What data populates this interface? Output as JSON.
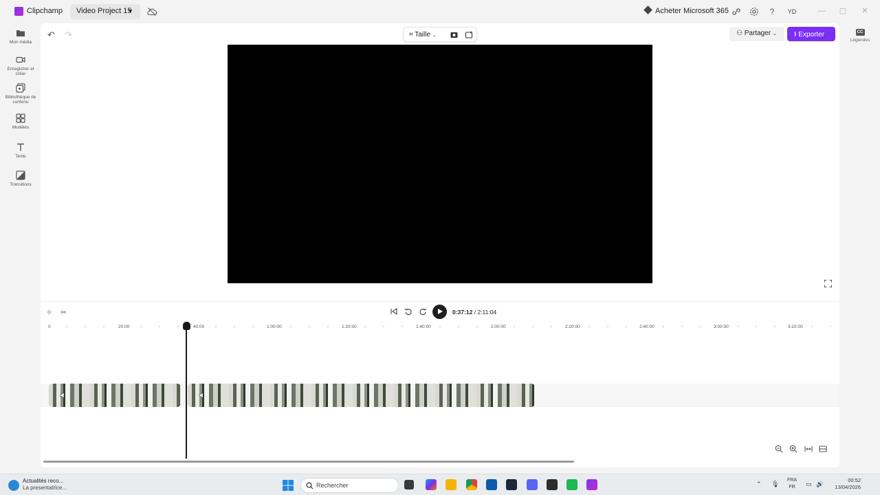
{
  "titlebar": {
    "app_name": "Clipchamp",
    "project_name": "Video Project 15",
    "buy_label": "Acheter Microsoft 365",
    "avatar_initials": "YD"
  },
  "sidebar": {
    "items": [
      {
        "label": "Mon média",
        "icon": "folder-icon"
      },
      {
        "label": "Enregistrer et créer",
        "icon": "camera-icon"
      },
      {
        "label": "Bibliothèque de contenu",
        "icon": "library-icon"
      },
      {
        "label": "Modèles",
        "icon": "templates-icon"
      },
      {
        "label": "Texte",
        "icon": "text-icon"
      },
      {
        "label": "Transitions",
        "icon": "transitions-icon"
      }
    ]
  },
  "toolbar": {
    "size_label": "Taille",
    "share_label": "Partager",
    "export_label": "Exporter"
  },
  "right_rail": {
    "captions_label": "Légendes",
    "captions_icon_text": "CC"
  },
  "playback": {
    "current_time": "0:37:12",
    "separator": "/",
    "total_time": "2:11:04"
  },
  "ruler": {
    "labels": [
      "0",
      "20:00",
      "40:00",
      "1:00:00",
      "1:20:00",
      "1:40:00",
      "2:00:00",
      "2:20:00",
      "2:40:00",
      "3:00:00",
      "3:20:00"
    ]
  },
  "taskbar": {
    "news_title": "Actualités reco...",
    "news_subtitle": "La presentatrice...",
    "search_placeholder": "Rechercher",
    "lang_line1": "FRA",
    "lang_line2": "FR",
    "time": "00:52",
    "date": "13/04/2026"
  },
  "colors": {
    "accent": "#7b2ff2",
    "preview_bg": "#000000"
  }
}
